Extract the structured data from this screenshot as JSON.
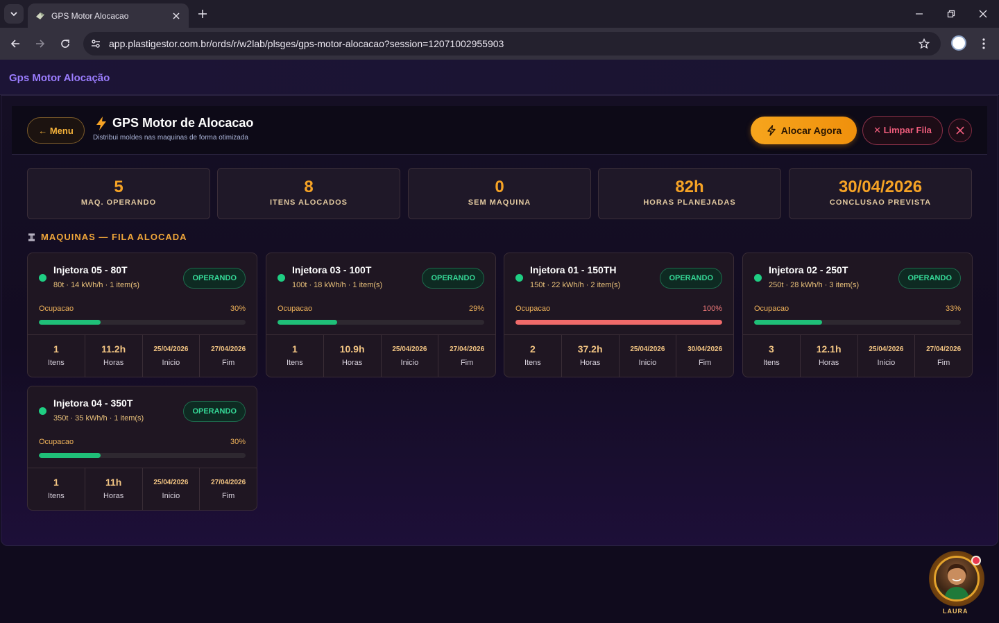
{
  "browser": {
    "tab_title": "GPS Motor Alocacao",
    "url": "app.plastigestor.com.br/ords/r/w2lab/plsges/gps-motor-alocacao?session=12071002955903"
  },
  "app": {
    "title": "Gps Motor Alocação"
  },
  "header": {
    "menu_label": "← Menu",
    "title": "GPS Motor de Alocacao",
    "subtitle": "Distribui moldes nas maquinas de forma otimizada",
    "alocar_label": "Alocar Agora",
    "limpar_label": "✕ Limpar Fila"
  },
  "stats": [
    {
      "value": "5",
      "label": "MAQ. OPERANDO"
    },
    {
      "value": "8",
      "label": "ITENS ALOCADOS"
    },
    {
      "value": "0",
      "label": "SEM MAQUINA"
    },
    {
      "value": "82h",
      "label": "HORAS PLANEJADAS"
    },
    {
      "value": "30/04/2026",
      "label": "CONCLUSAO PREVISTA"
    }
  ],
  "section_title": "MAQUINAS — FILA ALOCADA",
  "machines": [
    {
      "name": "Injetora 05 - 80T",
      "sub": "80t · 14 kWh/h · 1 item(s)",
      "status": "OPERANDO",
      "occupancy_label": "Ocupacao",
      "occupancy_pct": "30%",
      "occupancy": 30,
      "itens": "1",
      "itens_label": "Itens",
      "horas": "11.2h",
      "horas_label": "Horas",
      "inicio": "25/04/2026",
      "inicio_label": "Inicio",
      "fim": "27/04/2026",
      "fim_label": "Fim"
    },
    {
      "name": "Injetora 03 - 100T",
      "sub": "100t · 18 kWh/h · 1 item(s)",
      "status": "OPERANDO",
      "occupancy_label": "Ocupacao",
      "occupancy_pct": "29%",
      "occupancy": 29,
      "itens": "1",
      "itens_label": "Itens",
      "horas": "10.9h",
      "horas_label": "Horas",
      "inicio": "25/04/2026",
      "inicio_label": "Inicio",
      "fim": "27/04/2026",
      "fim_label": "Fim"
    },
    {
      "name": "Injetora 01 - 150TH",
      "sub": "150t · 22 kWh/h · 2 item(s)",
      "status": "OPERANDO",
      "occupancy_label": "Ocupacao",
      "occupancy_pct": "100%",
      "occupancy": 100,
      "itens": "2",
      "itens_label": "Itens",
      "horas": "37.2h",
      "horas_label": "Horas",
      "inicio": "25/04/2026",
      "inicio_label": "Inicio",
      "fim": "30/04/2026",
      "fim_label": "Fim"
    },
    {
      "name": "Injetora 02 - 250T",
      "sub": "250t · 28 kWh/h · 3 item(s)",
      "status": "OPERANDO",
      "occupancy_label": "Ocupacao",
      "occupancy_pct": "33%",
      "occupancy": 33,
      "itens": "3",
      "itens_label": "Itens",
      "horas": "12.1h",
      "horas_label": "Horas",
      "inicio": "25/04/2026",
      "inicio_label": "Inicio",
      "fim": "27/04/2026",
      "fim_label": "Fim"
    },
    {
      "name": "Injetora 04 - 350T",
      "sub": "350t · 35 kWh/h · 1 item(s)",
      "status": "OPERANDO",
      "occupancy_label": "Ocupacao",
      "occupancy_pct": "30%",
      "occupancy": 30,
      "itens": "1",
      "itens_label": "Itens",
      "horas": "11h",
      "horas_label": "Horas",
      "inicio": "25/04/2026",
      "inicio_label": "Inicio",
      "fim": "27/04/2026",
      "fim_label": "Fim"
    }
  ],
  "assistant": {
    "name": "LAURA"
  },
  "colors": {
    "accent": "#f6a325",
    "brand_purple": "#9b7dff",
    "status_green": "#1fce83",
    "status_full": "#f06a6a"
  },
  "icons": [
    "chevron-down-icon",
    "favicon-icon",
    "close-icon",
    "plus-icon",
    "minimize-icon",
    "restore-icon",
    "back-arrow-icon",
    "forward-arrow-icon",
    "reload-icon",
    "site-info-icon",
    "star-icon",
    "kebab-icon",
    "bolt-icon",
    "machine-icon"
  ]
}
